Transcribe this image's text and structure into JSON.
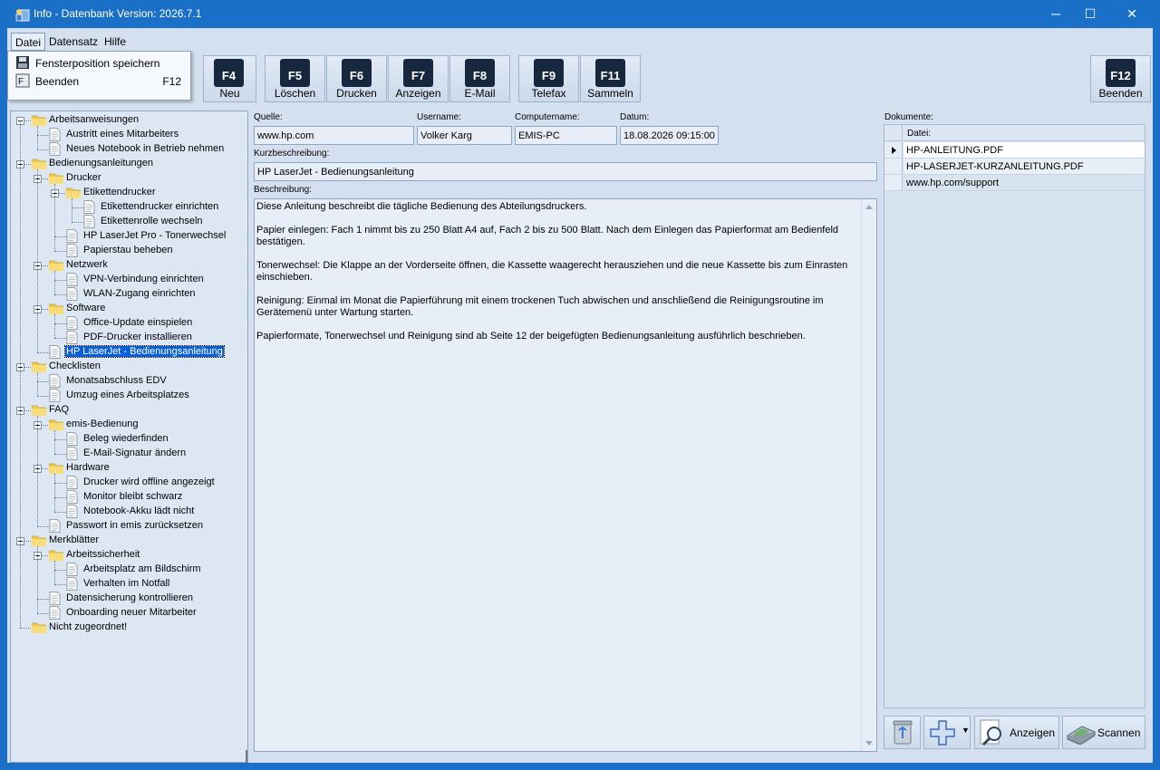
{
  "window": {
    "title": "Info - Datenbank Version: 2026.7.1",
    "minimize": "─",
    "maximize": "☐",
    "close": "✕"
  },
  "menubar": {
    "items": [
      "Datei",
      "Datensatz",
      "Hilfe"
    ],
    "open_menu": "Datei",
    "dropdown": [
      {
        "label": "Fensterposition speichern",
        "shortcut": "",
        "icon": "floppy-disk-icon"
      },
      {
        "label": "Beenden",
        "shortcut": "F12",
        "icon": "exit-icon"
      }
    ]
  },
  "toolbar": {
    "buttons": [
      {
        "key": "F4",
        "label": "Neu"
      },
      {
        "key": "F5",
        "label": "Löschen"
      },
      {
        "key": "F6",
        "label": "Drucken"
      },
      {
        "key": "F7",
        "label": "Anzeigen"
      },
      {
        "key": "F8",
        "label": "E-Mail"
      },
      {
        "key": "F9",
        "label": "Telefax"
      },
      {
        "key": "F11",
        "label": "Sammeln"
      },
      {
        "key": "F12",
        "label": "Beenden"
      }
    ]
  },
  "tree": {
    "nodes": [
      {
        "label": "Arbeitsanweisungen",
        "type": "folder",
        "level": 0,
        "expanded": true
      },
      {
        "label": "Austritt eines Mitarbeiters",
        "type": "doc",
        "level": 1
      },
      {
        "label": "Neues Notebook in Betrieb nehmen",
        "type": "doc",
        "level": 1
      },
      {
        "label": "Bedienungsanleitungen",
        "type": "folder",
        "level": 0,
        "expanded": true
      },
      {
        "label": "Drucker",
        "type": "folder",
        "level": 1,
        "expanded": true
      },
      {
        "label": "Etikettendrucker",
        "type": "folder",
        "level": 2,
        "expanded": true
      },
      {
        "label": "Etikettendrucker einrichten",
        "type": "doc",
        "level": 3
      },
      {
        "label": "Etikettenrolle wechseln",
        "type": "doc",
        "level": 3
      },
      {
        "label": "HP LaserJet Pro - Tonerwechsel",
        "type": "doc",
        "level": 2
      },
      {
        "label": "Papierstau beheben",
        "type": "doc",
        "level": 2
      },
      {
        "label": "Netzwerk",
        "type": "folder",
        "level": 1,
        "expanded": true
      },
      {
        "label": "VPN-Verbindung einrichten",
        "type": "doc",
        "level": 2
      },
      {
        "label": "WLAN-Zugang einrichten",
        "type": "doc",
        "level": 2
      },
      {
        "label": "Software",
        "type": "folder",
        "level": 1,
        "expanded": true
      },
      {
        "label": "Office-Update einspielen",
        "type": "doc",
        "level": 2
      },
      {
        "label": "PDF-Drucker installieren",
        "type": "doc",
        "level": 2
      },
      {
        "label": "HP LaserJet - Bedienungsanleitung",
        "type": "doc",
        "level": 1,
        "selected": true
      },
      {
        "label": "Checklisten",
        "type": "folder",
        "level": 0,
        "expanded": true
      },
      {
        "label": "Monatsabschluss EDV",
        "type": "doc",
        "level": 1
      },
      {
        "label": "Umzug eines Arbeitsplatzes",
        "type": "doc",
        "level": 1
      },
      {
        "label": "FAQ",
        "type": "folder",
        "level": 0,
        "expanded": true
      },
      {
        "label": "emis-Bedienung",
        "type": "folder",
        "level": 1,
        "expanded": true
      },
      {
        "label": "Beleg wiederfinden",
        "type": "doc",
        "level": 2
      },
      {
        "label": "E-Mail-Signatur ändern",
        "type": "doc",
        "level": 2
      },
      {
        "label": "Hardware",
        "type": "folder",
        "level": 1,
        "expanded": true
      },
      {
        "label": "Drucker wird offline angezeigt",
        "type": "doc",
        "level": 2
      },
      {
        "label": "Monitor bleibt schwarz",
        "type": "doc",
        "level": 2
      },
      {
        "label": "Notebook-Akku lädt nicht",
        "type": "doc",
        "level": 2
      },
      {
        "label": "Passwort in emis zurücksetzen",
        "type": "doc",
        "level": 1
      },
      {
        "label": "Merkblätter",
        "type": "folder",
        "level": 0,
        "expanded": true
      },
      {
        "label": "Arbeitssicherheit",
        "type": "folder",
        "level": 1,
        "expanded": true
      },
      {
        "label": "Arbeitsplatz am Bildschirm",
        "type": "doc",
        "level": 2
      },
      {
        "label": "Verhalten im Notfall",
        "type": "doc",
        "level": 2
      },
      {
        "label": "Datensicherung kontrollieren",
        "type": "doc",
        "level": 1
      },
      {
        "label": "Onboarding neuer Mitarbeiter",
        "type": "doc",
        "level": 1
      },
      {
        "label": "Nicht zugeordnet!",
        "type": "folder",
        "level": 0,
        "expanded": false
      }
    ]
  },
  "form": {
    "quelle_label": "Quelle:",
    "quelle_value": "www.hp.com",
    "username_label": "Username:",
    "username_value": "Volker Karg",
    "computer_label": "Computername:",
    "computer_value": "EMIS-PC",
    "datum_label": "Datum:",
    "datum_value": "18.08.2026 09:15:00",
    "kurz_label": "Kurzbeschreibung:",
    "kurz_value": "HP LaserJet - Bedienungsanleitung",
    "beschreibung_label": "Beschreibung:",
    "beschreibung_paragraphs": [
      "Diese Anleitung beschreibt die tägliche Bedienung des Abteilungsdruckers.",
      "Papier einlegen: Fach 1 nimmt bis zu 250 Blatt A4 auf, Fach 2 bis zu 500 Blatt. Nach dem Einlegen das Papierformat am Bedienfeld bestätigen.",
      "Tonerwechsel: Die Klappe an der Vorderseite öffnen, die Kassette waagerecht herausziehen und die neue Kassette bis zum Einrasten einschieben.",
      "Reinigung: Einmal im Monat die Papierführung mit einem trockenen Tuch abwischen und anschließend die Reinigungsroutine im Gerätemenü unter Wartung starten.",
      "Papierformate, Tonerwechsel und Reinigung sind ab Seite 12 der beigefügten Bedienungsanleitung ausführlich beschrieben."
    ]
  },
  "documents": {
    "label": "Dokumente:",
    "column_header": "Datei:",
    "rows": [
      "HP-ANLEITUNG.PDF",
      "HP-LASERJET-KURZANLEITUNG.PDF",
      "www.hp.com/support"
    ]
  },
  "bottom_buttons": {
    "delete_icon": "recycle-bin-icon",
    "add_icon": "plus-icon",
    "show_label": "Anzeigen",
    "scan_label": "Scannen"
  }
}
